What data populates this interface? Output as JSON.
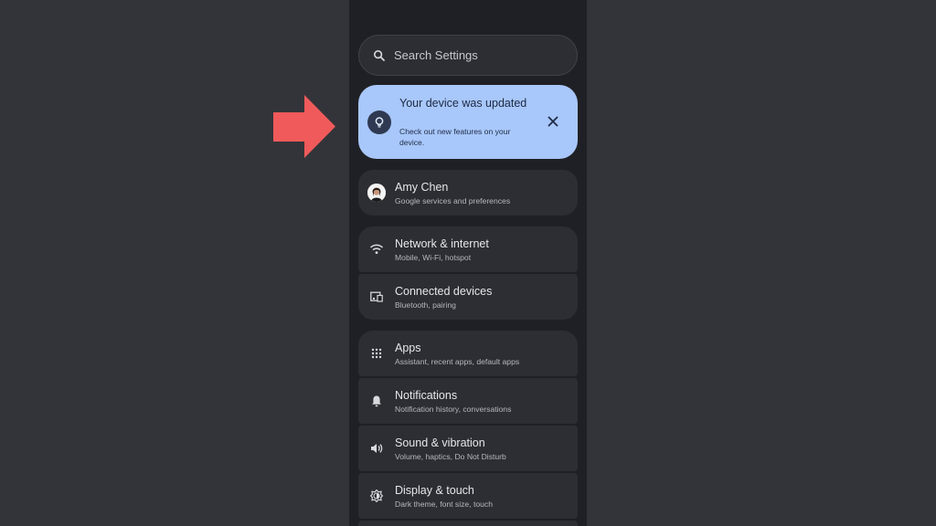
{
  "search": {
    "label": "Search Settings",
    "icon": "search-icon"
  },
  "banner": {
    "title": "Your device was updated",
    "subtitle": "Check out new features on your device.",
    "icon": "lightbulb-icon",
    "close_icon": "close-icon",
    "background": "#a8c7fa"
  },
  "account": {
    "name": "Amy Chen",
    "subtitle": "Google services and preferences"
  },
  "settings": [
    {
      "title": "Network & internet",
      "subtitle": "Mobile, Wi‑Fi, hotspot",
      "icon": "wifi-icon"
    },
    {
      "title": "Connected devices",
      "subtitle": "Bluetooth, pairing",
      "icon": "devices-icon"
    },
    {
      "title": "Apps",
      "subtitle": "Assistant, recent apps, default apps",
      "icon": "apps-grid-icon"
    },
    {
      "title": "Notifications",
      "subtitle": "Notification history, conversations",
      "icon": "bell-icon"
    },
    {
      "title": "Sound & vibration",
      "subtitle": "Volume, haptics, Do Not Disturb",
      "icon": "volume-icon"
    },
    {
      "title": "Display & touch",
      "subtitle": "Dark theme, font size, touch",
      "icon": "brightness-icon"
    }
  ],
  "colors": {
    "arrow": "#f05a5a",
    "page_background": "#333439",
    "panel_background": "#1f2025",
    "card_background": "#2c2e33"
  }
}
